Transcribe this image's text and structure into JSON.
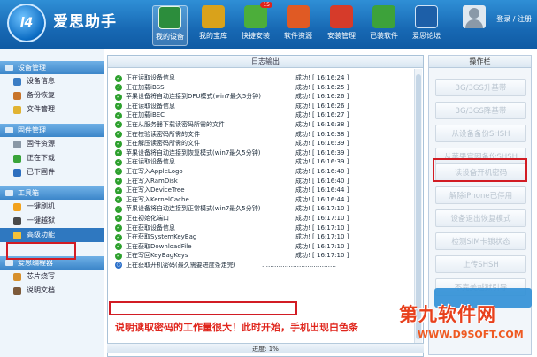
{
  "app": {
    "logo_text": "i4",
    "title": "爱思助手"
  },
  "nav": [
    {
      "label": "我的设备",
      "icon": "device-icon",
      "color": "#2c8d3c"
    },
    {
      "label": "我的宝库",
      "icon": "chart-icon",
      "color": "#d9a21b"
    },
    {
      "label": "快捷安装",
      "icon": "install-icon",
      "color": "#4cae3a",
      "badge": "15"
    },
    {
      "label": "软件资源",
      "icon": "apps-icon",
      "color": "#e05a24"
    },
    {
      "label": "安装管理",
      "icon": "manage-icon",
      "color": "#d63b2a"
    },
    {
      "label": "已装软件",
      "icon": "check-icon",
      "color": "#3da23a"
    },
    {
      "label": "爱思论坛",
      "icon": "forum-icon",
      "color": "#1d5fa8"
    }
  ],
  "header": {
    "login": "登录",
    "separator": "/",
    "register": "注册"
  },
  "sidebar": {
    "device_head": "设备管理",
    "device_items": [
      "设备信息",
      "备份恢复",
      "文件管理"
    ],
    "firmware_head": "固件管理",
    "firmware_items": [
      "固件资源",
      "正在下载",
      "已下固件"
    ],
    "tools_head": "工具箱",
    "tools_items": [
      "一键刷机",
      "一键越狱",
      "高级功能"
    ],
    "editor_head": "爱思编程器",
    "editor_items": [
      "芯片烧写",
      "说明文档"
    ]
  },
  "log": {
    "title": "日志输出",
    "rows": [
      {
        "msg": "正在读取设备信息",
        "res": "成功! [ 16:16:24 ]"
      },
      {
        "msg": "正在加载iBSS",
        "res": "成功! [ 16:16:25 ]"
      },
      {
        "msg": "苹果设备将自动连接到DFU模式(win7最久5分钟)",
        "res": "成功! [ 16:16:26 ]"
      },
      {
        "msg": "正在读取设备信息",
        "res": "成功! [ 16:16:26 ]"
      },
      {
        "msg": "正在加载iBEC",
        "res": "成功! [ 16:16:27 ]"
      },
      {
        "msg": "正在从服务器下载读密码所需的文件",
        "res": "成功! [ 16:16:38 ]"
      },
      {
        "msg": "正在校验读密码所需的文件",
        "res": "成功! [ 16:16:38 ]"
      },
      {
        "msg": "正在解压读密码所需的文件",
        "res": "成功! [ 16:16:39 ]"
      },
      {
        "msg": "苹果设备将自动连接到恢复模式(win7最久5分钟)",
        "res": "成功! [ 16:16:39 ]"
      },
      {
        "msg": "正在读取设备信息",
        "res": "成功! [ 16:16:39 ]"
      },
      {
        "msg": "正在写入AppleLogo",
        "res": "成功! [ 16:16:40 ]"
      },
      {
        "msg": "正在写入RamDisk",
        "res": "成功! [ 16:16:40 ]"
      },
      {
        "msg": "正在写入DeviceTree",
        "res": "成功! [ 16:16:44 ]"
      },
      {
        "msg": "正在写入KernelCache",
        "res": "成功! [ 16:16:44 ]"
      },
      {
        "msg": "苹果设备将自动连接到正常模式(win7最久5分钟)",
        "res": "成功! [ 16:17:10 ]"
      },
      {
        "msg": "正在初始化端口",
        "res": "成功! [ 16:17:10 ]"
      },
      {
        "msg": "正在获取设备信息",
        "res": "成功! [ 16:17:10 ]"
      },
      {
        "msg": "正在获取SystemKeyBag",
        "res": "成功! [ 16:17:10 ]"
      },
      {
        "msg": "正在获取DownloadFile",
        "res": "成功! [ 16:17:10 ]"
      },
      {
        "msg": "正在写回KeyBagKeys",
        "res": "成功! [ 16:17:10 ]"
      }
    ],
    "current": "正在获取开机密码(最久需要进度条走完)",
    "current_dots": "………………………………",
    "progress_label": "进度:",
    "progress_value": "1%"
  },
  "ops": {
    "title": "操作栏",
    "buttons": [
      "3G/3GS升基带",
      "3G/3GS降基带",
      "从设备备份SHSH",
      "从苹果官网备份SHSH",
      "读设备开机密码",
      "解除iPhone已停用",
      "设备退出恢复模式",
      "检测SIM卡锁状态",
      "上传SHSH",
      "不完美越狱引导"
    ]
  },
  "caption": "说明读取密码的工作量很大！此时开始，手机出现白色条",
  "watermark": {
    "text": "第九软件网",
    "url": "WWW.D9SOFT.COM"
  }
}
